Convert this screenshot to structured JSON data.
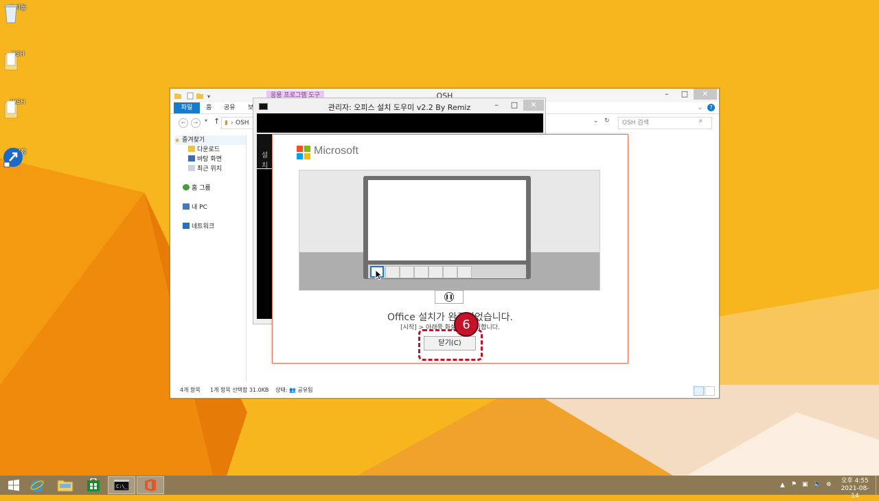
{
  "desktop": {
    "icons": [
      {
        "label": "휴지통"
      },
      {
        "label": "OSH"
      },
      {
        "label": "WSH"
      },
      {
        "label": "원격접"
      }
    ]
  },
  "explorer": {
    "context_tab": "응용 프로그램 도구",
    "title": "OSH",
    "ribbon": {
      "file": "파일",
      "home": "홈",
      "share": "공유",
      "view": "보"
    },
    "address": "OSH",
    "search_placeholder": "OSH 검색",
    "nav": {
      "favorites": "즐겨찾기",
      "downloads": "다운로드",
      "desktop": "바탕 화면",
      "recent": "최근 위치",
      "homegroup": "홈 그룹",
      "this_pc": "내 PC",
      "network": "네트워크"
    },
    "status": {
      "items": "4개 항목",
      "selected": "1개 항목 선택함 31.0KB",
      "state": "상태: 👥 공유됨"
    }
  },
  "console": {
    "title": "관리자:  오피스 설치 도우미 v2.2 By Remiz",
    "side_text": "설치"
  },
  "installer": {
    "brand": "Microsoft",
    "message": "Office 설치가 완료되었습니다.",
    "sub_message": "[시작] > 아래쪽 화살표를 클릭합니다.",
    "close_label": "닫기(C)",
    "callout_number": "6"
  },
  "taskbar": {
    "clock_time": "오후 4:55",
    "clock_date": "2021-08-14"
  },
  "colors": {
    "desktop": "#f6b21a",
    "accent_blue": "#1979ca",
    "callout_red": "#c4122a",
    "office_orange": "#e5542a"
  }
}
